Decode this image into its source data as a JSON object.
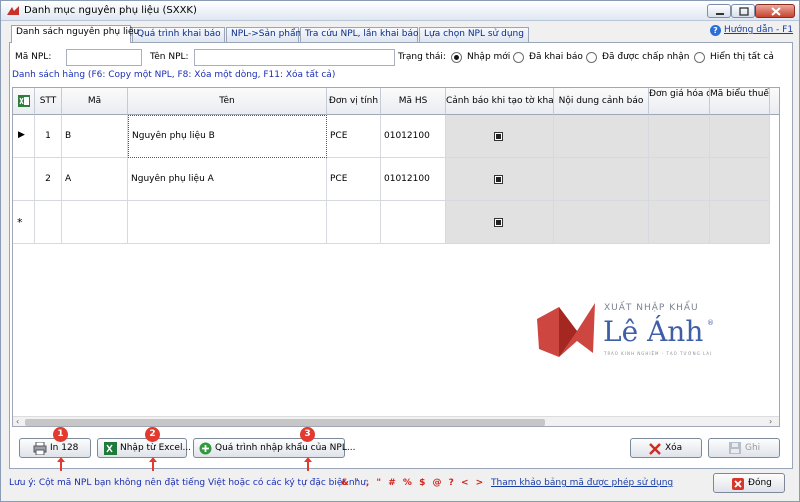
{
  "window": {
    "title": "Danh mục nguyên phụ liệu (SXXK)"
  },
  "tabs": [
    {
      "label": "Danh sách nguyên phụ liệu"
    },
    {
      "label": "Quá trình khai báo"
    },
    {
      "label": "NPL->Sản phẩm"
    },
    {
      "label": "Tra cứu NPL, lần khai báo"
    },
    {
      "label": "Lựa chọn NPL sử dụng"
    }
  ],
  "help": {
    "label": "Hướng dẫn - F1"
  },
  "filters": {
    "ma_label": "Mã NPL:",
    "ma_value": "",
    "ten_label": "Tên NPL:",
    "ten_value": "",
    "status_label": "Trạng thái:",
    "options": [
      "Nhập mới",
      "Đã khai báo",
      "Đã được chấp nhận",
      "Hiển thị tất cả"
    ]
  },
  "list_hint": "Danh sách hàng (F6: Copy một NPL, F8: Xóa một dòng, F11: Xóa tất cả)",
  "grid": {
    "columns": [
      "STT",
      "Mã",
      "Tên",
      "Đơn vị tính",
      "Mã HS",
      "Cảnh báo khi tạo tờ khai",
      "Nội dung cảnh báo",
      "Đơn giá hóa đơn",
      "Mã biểu thuế XNK"
    ],
    "rows": [
      {
        "stt": "1",
        "ma": "B",
        "ten": "Nguyên phụ liệu B",
        "dvt": "PCE",
        "mahs": "01012100"
      },
      {
        "stt": "2",
        "ma": "A",
        "ten": "Nguyên phụ liệu A",
        "dvt": "PCE",
        "mahs": "01012100"
      }
    ],
    "new_row_marker": "*",
    "current_row_marker": "▶"
  },
  "buttons": {
    "print": "In 128",
    "import_excel": "Nhập từ Excel...",
    "import_process": "Quá trình nhập khẩu của NPL...",
    "delete": "Xóa",
    "save": "Ghi",
    "close": "Đóng"
  },
  "badges": [
    "1",
    "2",
    "3"
  ],
  "note": {
    "text": "Lưu ý: Cột mã NPL bạn không nên đặt tiếng Việt hoặc có các ký tự đặc biệt như:",
    "chars": "& ' , \" # % $ @ ? < >",
    "link": "Tham khảo bảng mã được phép sử dụng"
  },
  "watermark": {
    "top": "XUẤT NHẬP KHẨU",
    "main": "Lê Ánh",
    "reg": "®",
    "tagline": "TRAO KINH NGHIỆM - TẠO TƯƠNG LAI"
  },
  "colors": {
    "accent_red": "#e23a2f",
    "link_blue": "#1a3ea8",
    "logo_blue": "#3f5ea8"
  }
}
